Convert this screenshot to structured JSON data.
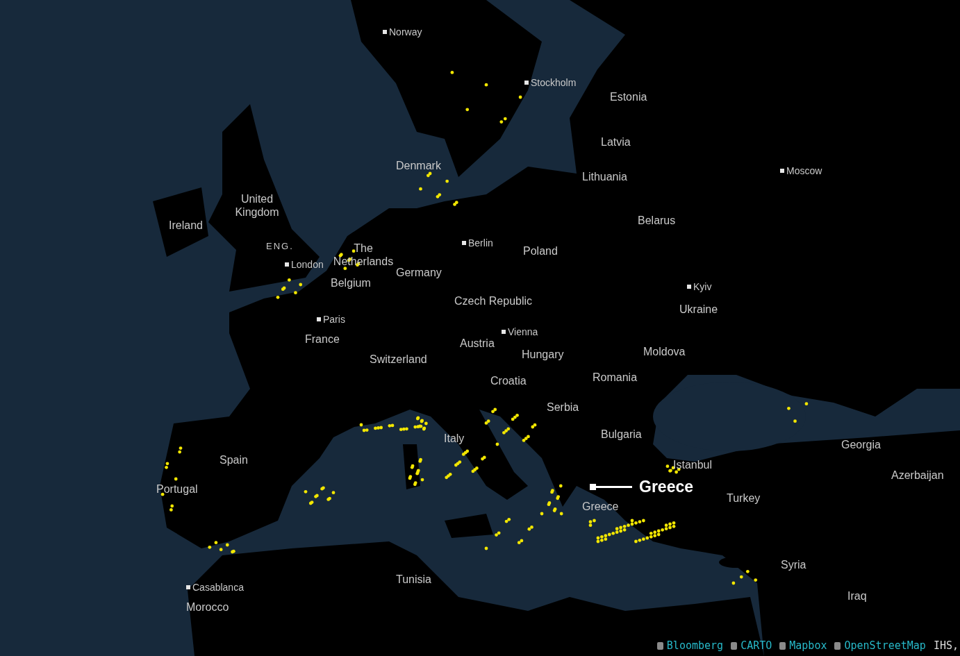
{
  "map": {
    "labels": [
      {
        "text": "Norway",
        "kind": "city"
      },
      {
        "text": "Stockholm",
        "kind": "city"
      },
      {
        "text": "Estonia",
        "kind": "country"
      },
      {
        "text": "Latvia",
        "kind": "country"
      },
      {
        "text": "Denmark",
        "kind": "country"
      },
      {
        "text": "Lithuania",
        "kind": "country"
      },
      {
        "text": "Moscow",
        "kind": "city"
      },
      {
        "text": "United Kingdom",
        "kind": "country"
      },
      {
        "text": "Ireland",
        "kind": "country"
      },
      {
        "text": "Belarus",
        "kind": "country"
      },
      {
        "text": "ENG.",
        "kind": "region"
      },
      {
        "text": "Berlin",
        "kind": "city"
      },
      {
        "text": "The Netherlands",
        "kind": "country"
      },
      {
        "text": "Poland",
        "kind": "country"
      },
      {
        "text": "London",
        "kind": "city"
      },
      {
        "text": "Germany",
        "kind": "country"
      },
      {
        "text": "Belgium",
        "kind": "country"
      },
      {
        "text": "Kyiv",
        "kind": "city"
      },
      {
        "text": "Czech Republic",
        "kind": "country"
      },
      {
        "text": "Ukraine",
        "kind": "country"
      },
      {
        "text": "Paris",
        "kind": "city"
      },
      {
        "text": "Vienna",
        "kind": "city"
      },
      {
        "text": "France",
        "kind": "country"
      },
      {
        "text": "Austria",
        "kind": "country"
      },
      {
        "text": "Moldova",
        "kind": "country"
      },
      {
        "text": "Switzerland",
        "kind": "country"
      },
      {
        "text": "Hungary",
        "kind": "country"
      },
      {
        "text": "Romania",
        "kind": "country"
      },
      {
        "text": "Croatia",
        "kind": "country"
      },
      {
        "text": "Serbia",
        "kind": "country"
      },
      {
        "text": "Bulgaria",
        "kind": "country"
      },
      {
        "text": "Italy",
        "kind": "country"
      },
      {
        "text": "Georgia",
        "kind": "country"
      },
      {
        "text": "Spain",
        "kind": "country"
      },
      {
        "text": "Istanbul",
        "kind": "country"
      },
      {
        "text": "Azerbaijan",
        "kind": "country"
      },
      {
        "text": "Portugal",
        "kind": "country"
      },
      {
        "text": "Turkey",
        "kind": "country"
      },
      {
        "text": "Greece",
        "kind": "country"
      },
      {
        "text": "Syria",
        "kind": "country"
      },
      {
        "text": "Tunisia",
        "kind": "country"
      },
      {
        "text": "Casablanca",
        "kind": "city"
      },
      {
        "text": "Iraq",
        "kind": "country"
      },
      {
        "text": "Morocco",
        "kind": "country"
      }
    ],
    "callout": {
      "text": "Greece"
    },
    "attribution": [
      {
        "text": "Bloomberg",
        "kind": "link"
      },
      {
        "text": "CARTO",
        "kind": "link"
      },
      {
        "text": "Mapbox",
        "kind": "link"
      },
      {
        "text": "OpenStreetMap",
        "kind": "link"
      },
      {
        "text": "IHS,",
        "kind": "plain"
      }
    ]
  }
}
